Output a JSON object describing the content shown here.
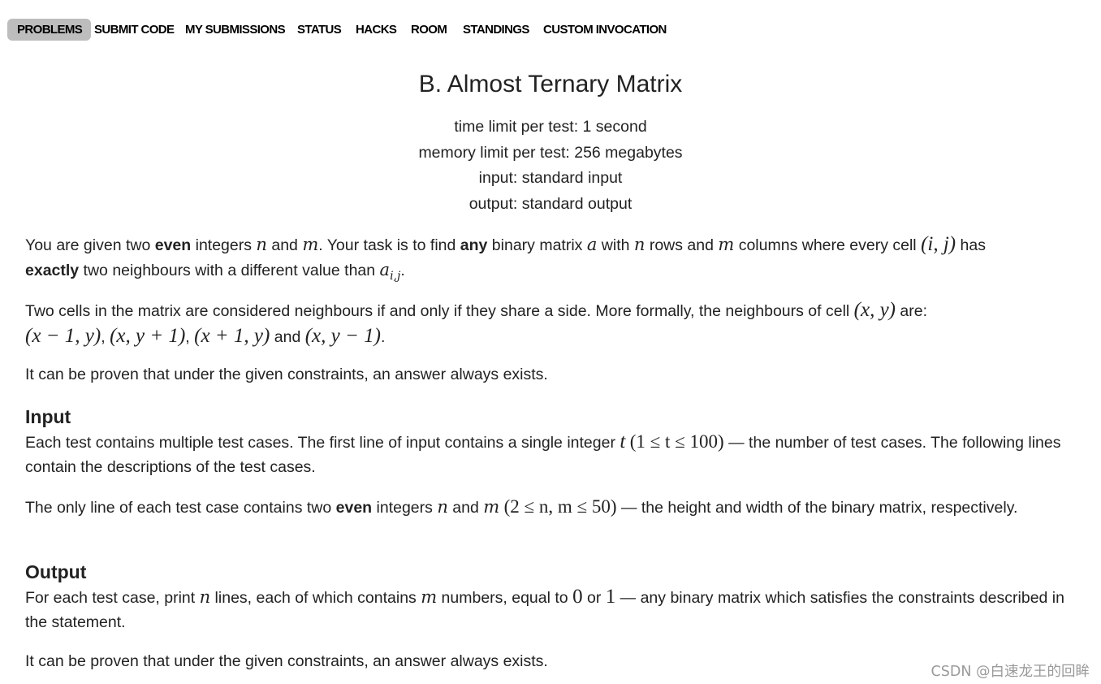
{
  "nav": {
    "items": [
      {
        "label": "PROBLEMS",
        "active": true
      },
      {
        "label": "SUBMIT CODE",
        "active": false
      },
      {
        "label": "MY SUBMISSIONS",
        "active": false
      },
      {
        "label": "STATUS",
        "active": false
      },
      {
        "label": "HACKS",
        "active": false
      },
      {
        "label": "ROOM",
        "active": false
      },
      {
        "label": "STANDINGS",
        "active": false
      },
      {
        "label": "CUSTOM INVOCATION",
        "active": false
      }
    ]
  },
  "problem": {
    "title": "B. Almost Ternary Matrix",
    "time_limit": "time limit per test: 1 second",
    "memory_limit": "memory limit per test: 256 megabytes",
    "input": "input: standard input",
    "output": "output: standard output"
  },
  "statement": {
    "p1": {
      "t1": "You are given two ",
      "b1": "even",
      "t2": " integers ",
      "m_n": "n",
      "t3": " and ",
      "m_m": "m",
      "t4": ". Your task is to find ",
      "b2": "any",
      "t5": " binary matrix ",
      "m_a": "a",
      "t6": " with ",
      "m_n2": "n",
      "t7": " rows and ",
      "m_m2": "m",
      "t8": " columns where every cell ",
      "m_ij": "(i, j)",
      "t9": " has",
      "b3": "exactly",
      "t10": " two neighbours with a different value than ",
      "m_aij": "a",
      "m_aij_sub": "i,j",
      "t11": "."
    },
    "p2": {
      "t1": "Two cells in the matrix are considered neighbours if and only if they share a side. More formally, the neighbours of cell ",
      "m_xy": "(x, y)",
      "t2": " are:",
      "m_n1": "(x − 1, y)",
      "m_n2": "(x, y + 1)",
      "m_n3": "(x + 1, y)",
      "t3": " and ",
      "m_n4": "(x, y − 1)",
      "sep": ", ",
      "end": "."
    },
    "p3": "It can be proven that under the given constraints, an answer always exists."
  },
  "input_section": {
    "heading": "Input",
    "p1": {
      "t1": "Each test contains multiple test cases. The first line of input contains a single integer ",
      "m_t": "t",
      "m_range": "(1 ≤ t ≤ 100)",
      "t2": " — the number of test cases. The following lines contain the descriptions of the test cases."
    },
    "p2": {
      "t1": "The only line of each test case contains two ",
      "b1": "even",
      "t2": " integers ",
      "m_n": "n",
      "t3": " and ",
      "m_m": "m",
      "m_range": "(2 ≤ n, m ≤ 50)",
      "t4": " — the height and width of the binary matrix, respectively."
    }
  },
  "output_section": {
    "heading": "Output",
    "p1": {
      "t1": "For each test case, print ",
      "m_n": "n",
      "t2": " lines, each of which contains ",
      "m_m": "m",
      "t3": " numbers, equal to ",
      "m_0": "0",
      "t4": " or ",
      "m_1": "1",
      "t5": " — any binary matrix which satisfies the constraints described in the statement."
    },
    "p2": "It can be proven that under the given constraints, an answer always exists."
  },
  "watermark": "CSDN @白速龙王的回眸"
}
